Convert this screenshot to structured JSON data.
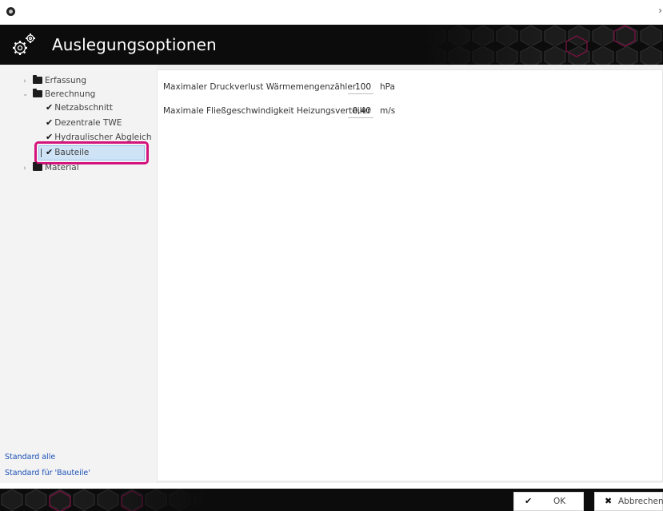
{
  "window": {
    "close_glyph": "›"
  },
  "header": {
    "title": "Auslegungsoptionen",
    "icon": "gears-icon"
  },
  "tree": {
    "items": [
      {
        "label": "Erfassung",
        "type": "folder",
        "expanded": false
      },
      {
        "label": "Berechnung",
        "type": "folder",
        "expanded": true
      },
      {
        "label": "Netzabschnitt",
        "type": "check",
        "checked": true
      },
      {
        "label": "Dezentrale TWE",
        "type": "check",
        "checked": true
      },
      {
        "label": "Hydraulischer Abgleich",
        "type": "check",
        "checked": true
      },
      {
        "label": "Bauteile",
        "type": "check",
        "checked": true,
        "selected": true
      },
      {
        "label": "Material",
        "type": "folder",
        "expanded": false
      }
    ]
  },
  "links": {
    "standard_all": "Standard alle",
    "standard_current": "Standard für 'Bauteile'"
  },
  "settings": [
    {
      "label": "Maximaler Druckverlust Wärmemengenzähler",
      "value": "100",
      "unit": "hPa"
    },
    {
      "label": "Maximale Fließgeschwindigkeit Heizungsverteiler",
      "value": "0,40",
      "unit": "m/s"
    }
  ],
  "buttons": {
    "ok": "OK",
    "cancel": "Abbrechen"
  },
  "colors": {
    "accent": "#d4137c",
    "header_bg": "#0c0c0c",
    "selection": "#cfe3f6",
    "link": "#1a4fb5"
  }
}
